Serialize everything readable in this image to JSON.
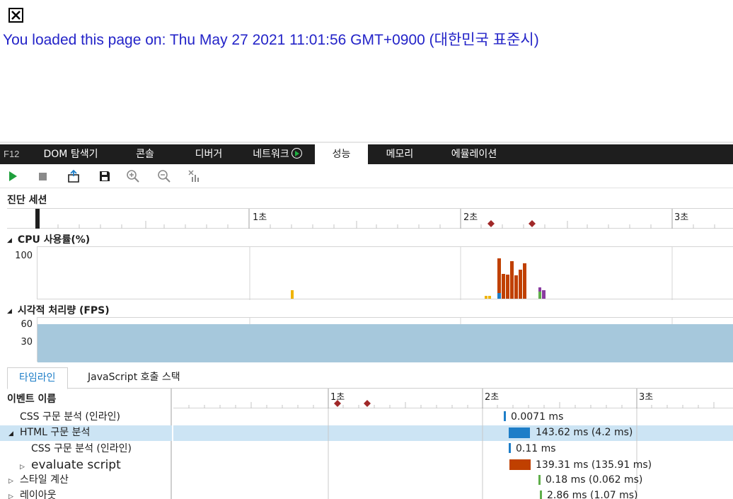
{
  "page": {
    "loaded_message": "You loaded this page on: Thu May 27 2021 11:01:56 GMT+0900 (대한민국 표준시)"
  },
  "tabbar": {
    "f12": "F12",
    "tabs": [
      "DOM 탐색기",
      "콘솔",
      "디버거",
      "네트워크",
      "성능",
      "메모리",
      "에뮬레이션"
    ],
    "active_tab": "성능"
  },
  "toolbar": {
    "icons": [
      "play-icon",
      "stop-icon",
      "import-icon",
      "save-icon",
      "zoom-in-icon",
      "zoom-out-icon",
      "clear-selection-icon"
    ]
  },
  "session": {
    "title": "진단 세션",
    "ticks": [
      "1초",
      "2초",
      "3초"
    ]
  },
  "cpu": {
    "title": "CPU 사용률(%)",
    "y_max": "100"
  },
  "fps": {
    "title": "시각적 처리량 (FPS)",
    "y_labels": [
      "60",
      "30"
    ]
  },
  "subtabs": {
    "timeline": "타임라인",
    "callstack": "JavaScript 호출 스택"
  },
  "events": {
    "header": "이벤트 이름",
    "rows": [
      {
        "name": "CSS 구문 분석 (인라인)",
        "duration": "0.0071 ms"
      },
      {
        "name": "HTML 구문 분석",
        "duration": "143.62 ms (4.2 ms)"
      },
      {
        "name": "CSS 구문 분석 (인라인)",
        "duration": "0.11 ms"
      },
      {
        "name": "evaluate script",
        "duration": "139.31 ms (135.91 ms)"
      },
      {
        "name": "스타일 계산",
        "duration": "0.18 ms (0.062 ms)"
      },
      {
        "name": "레이아웃",
        "duration": "2.86 ms (1.07 ms)"
      }
    ]
  },
  "colors": {
    "accent": "#1e7ec8",
    "css_bar": "#1e7ec8",
    "script_bar": "#c04000",
    "style_bar": "#5fae4a",
    "marker": "#a02828",
    "fps_fill": "#a6c8dc"
  }
}
